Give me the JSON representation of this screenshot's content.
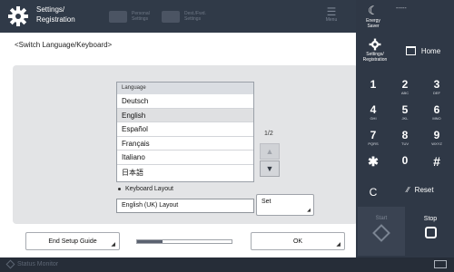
{
  "topbar": {
    "title": "Settings/\nRegistration",
    "tab_personal": "Personal\nSettings",
    "tab_device": "Dest./Fwd.\nSettings",
    "menu_label": "Menu"
  },
  "main": {
    "heading": "<Switch Language/Keyboard>",
    "language": {
      "header": "Language",
      "items": [
        "Deutsch",
        "English",
        "Español",
        "Français",
        "Italiano",
        "日本語"
      ],
      "selected_index": 1,
      "page_count": "1/2"
    },
    "keyboard": {
      "label": "Keyboard Layout",
      "value": "English (UK) Layout",
      "set_label": "Set"
    },
    "end_setup_label": "End Setup Guide",
    "progress_fraction": 0.27,
    "ok_label": "OK"
  },
  "statusbar": {
    "label": "Status Monitor"
  },
  "keypad": {
    "energy_saver": "Energy Saver",
    "dashes": "-----",
    "settings_label": "Settings/\nRegistration",
    "home_label": "Home",
    "keys": [
      {
        "n": "1",
        "s": ""
      },
      {
        "n": "2",
        "s": "ABC"
      },
      {
        "n": "3",
        "s": "DEF"
      },
      {
        "n": "4",
        "s": "GHI"
      },
      {
        "n": "5",
        "s": "JKL"
      },
      {
        "n": "6",
        "s": "MNO"
      },
      {
        "n": "7",
        "s": "PQRS"
      },
      {
        "n": "8",
        "s": "TUV"
      },
      {
        "n": "9",
        "s": "WXYZ"
      },
      {
        "n": "✱",
        "s": ""
      },
      {
        "n": "0",
        "s": ""
      },
      {
        "n": "#",
        "s": ""
      }
    ],
    "clear_label": "C",
    "reset_label": "Reset",
    "start_label": "Start",
    "stop_label": "Stop"
  },
  "colors": {
    "panel_bg": "#2f3846",
    "topbar_bg": "#303a48",
    "content_bg": "#ffffff",
    "gray_area": "#e3e4e6",
    "selected_row": "#dfe0e2"
  }
}
